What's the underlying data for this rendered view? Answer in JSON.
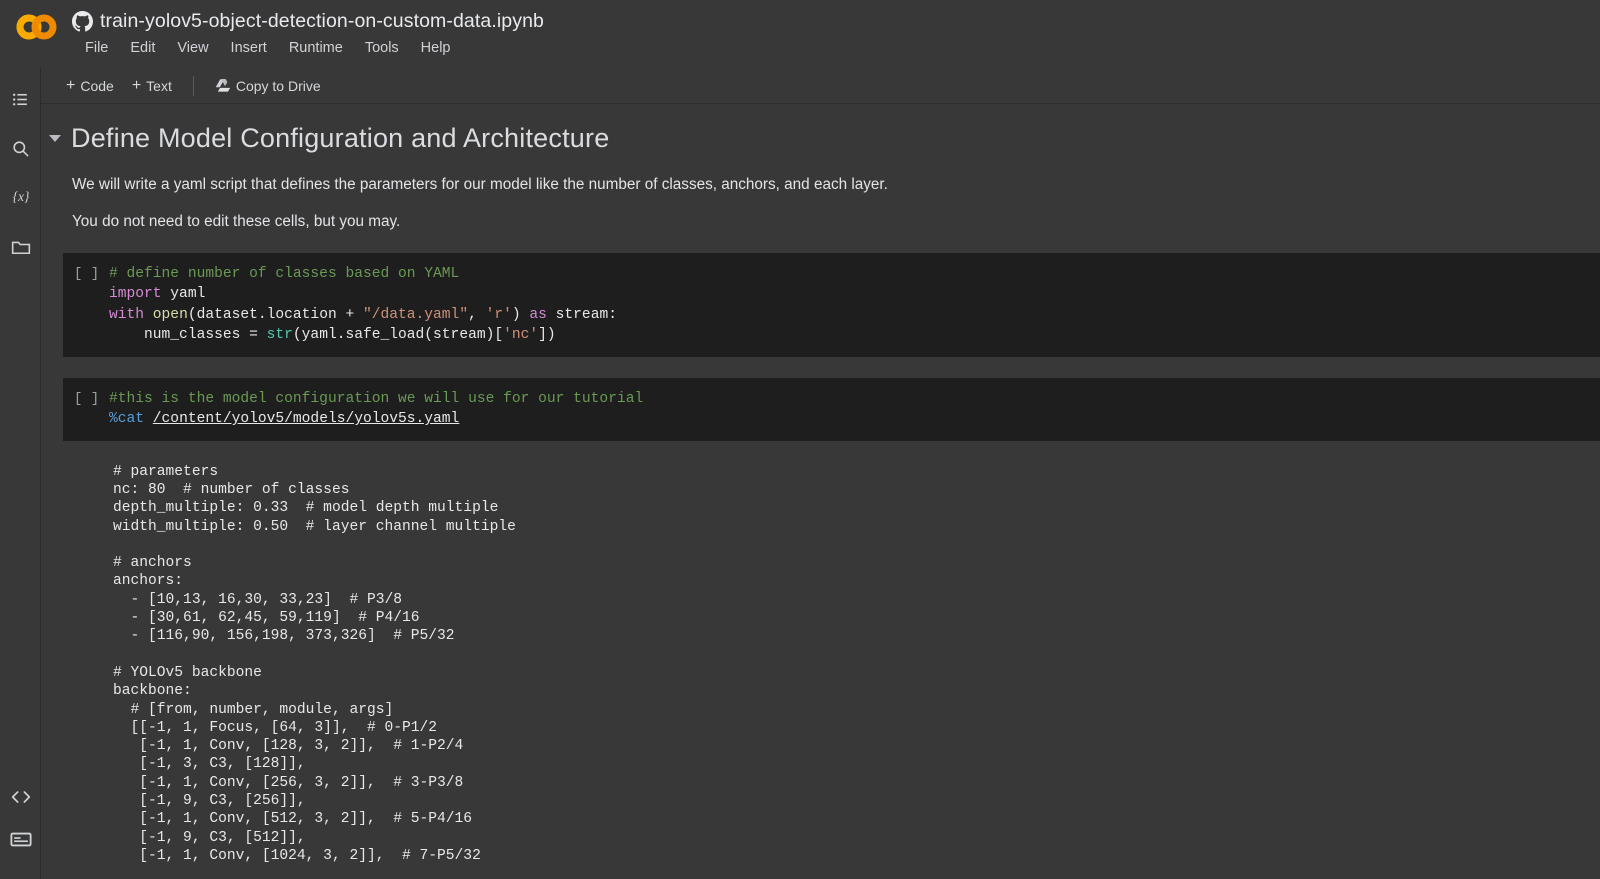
{
  "window": {
    "logo_alt": "colab-logo",
    "doc_icon": "github-icon",
    "doc_title": "train-yolov5-object-detection-on-custom-data.ipynb"
  },
  "menubar": {
    "items": [
      {
        "label": "File"
      },
      {
        "label": "Edit"
      },
      {
        "label": "View"
      },
      {
        "label": "Insert"
      },
      {
        "label": "Runtime"
      },
      {
        "label": "Tools"
      },
      {
        "label": "Help"
      }
    ]
  },
  "toolbar": {
    "add_code_label": "Code",
    "add_text_label": "Text",
    "plus": "+",
    "copy_to_drive_label": "Copy to Drive"
  },
  "sidebar": {
    "items": [
      {
        "name": "table-of-contents-icon",
        "label": "Table of contents"
      },
      {
        "name": "search-icon",
        "label": "Find and replace"
      },
      {
        "name": "variables-icon",
        "label": "Variables"
      },
      {
        "name": "files-folder-icon",
        "label": "Files"
      }
    ],
    "bottom_items": [
      {
        "name": "code-snippets-icon",
        "label": "Code snippets"
      },
      {
        "name": "terminal-icon",
        "label": "Terminal"
      }
    ]
  },
  "section": {
    "heading": "Define Model Configuration and Architecture",
    "paragraphs": [
      "We will write a yaml script that defines the parameters for our model like the number of classes, anchors, and each layer.",
      "You do not need to edit these cells, but you may."
    ]
  },
  "cells": [
    {
      "run_label": "[ ]",
      "lines": [
        "# define number of classes based on YAML",
        "import yaml",
        "with open(dataset.location + \"/data.yaml\", 'r') as stream:",
        "    num_classes = str(yaml.safe_load(stream)['nc'])"
      ]
    },
    {
      "run_label": "[ ]",
      "lines": [
        "#this is the model configuration we will use for our tutorial",
        "%cat /content/yolov5/models/yolov5s.yaml"
      ]
    }
  ],
  "output": {
    "text": "# parameters\nnc: 80  # number of classes\ndepth_multiple: 0.33  # model depth multiple\nwidth_multiple: 0.50  # layer channel multiple\n\n# anchors\nanchors:\n  - [10,13, 16,30, 33,23]  # P3/8\n  - [30,61, 62,45, 59,119]  # P4/16\n  - [116,90, 156,198, 373,326]  # P5/32\n\n# YOLOv5 backbone\nbackbone:\n  # [from, number, module, args]\n  [[-1, 1, Focus, [64, 3]],  # 0-P1/2\n   [-1, 1, Conv, [128, 3, 2]],  # 1-P2/4\n   [-1, 3, C3, [128]],\n   [-1, 1, Conv, [256, 3, 2]],  # 3-P3/8\n   [-1, 9, C3, [256]],\n   [-1, 1, Conv, [512, 3, 2]],  # 5-P4/16\n   [-1, 9, C3, [512]],\n   [-1, 1, Conv, [1024, 3, 2]],  # 7-P5/32"
  },
  "colors": {
    "page_background": "#383838",
    "code_background": "#1e1e1e",
    "accent_orange": "#f9ab00",
    "comment_green": "#6a9955",
    "keyword_pink": "#d68ad4",
    "string_salmon": "#ce9178",
    "builtin_teal": "#4ec9b0",
    "magic_blue": "#569cd6",
    "function_yellow": "#dcdcaa"
  }
}
